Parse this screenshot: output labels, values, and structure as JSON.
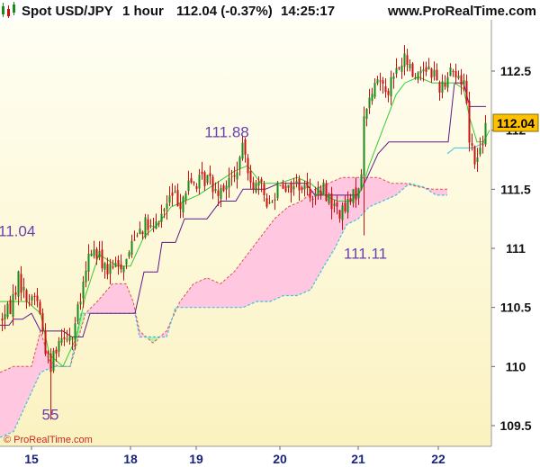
{
  "header": {
    "instrument": "Spot USD/JPY",
    "timeframe": "1 hour",
    "price_change": "112.04 (-0.37%)",
    "time": "14:25:17",
    "site": "www.ProRealTime.com"
  },
  "watermark": "© ProRealTime.com",
  "last_price_label": "112.04",
  "colors": {
    "background_top": "#fffff0",
    "background_bottom": "#fbf3c2",
    "candle_up": "#1b8a1b",
    "candle_down": "#cc1111",
    "tenkan": "#33cc33",
    "kijun": "#5a1a8a",
    "cloud_bearish": "#ffc8e0",
    "cloud_bullish": "#b8f0b0",
    "span_a": "#e05050",
    "span_b": "#40c0e0",
    "annotation": "#6a3fb0",
    "last_price_bg": "#ffc000"
  },
  "chart_data": {
    "type": "candlestick",
    "indicator": "Ichimoku cloud",
    "ylim": [
      109.3,
      113.05
    ],
    "y_ticks": [
      "109.5",
      "110",
      "110.5",
      "111",
      "111.5",
      "112",
      "112.5"
    ],
    "x_ticks": [
      "15",
      "18",
      "19",
      "20",
      "21",
      "22"
    ],
    "annotations": [
      {
        "text": "111.88",
        "price": 111.88
      },
      {
        "text": "11.04",
        "price": 111.04
      },
      {
        "text": "111.11",
        "price": 111.11
      },
      {
        "text": "55",
        "price": 109.55
      }
    ],
    "close_path": [
      [
        0,
        110.4
      ],
      [
        10,
        110.48
      ],
      [
        20,
        110.75
      ],
      [
        30,
        110.55
      ],
      [
        40,
        110.62
      ],
      [
        48,
        110.25
      ],
      [
        55,
        109.95
      ],
      [
        60,
        110.15
      ],
      [
        70,
        110.3
      ],
      [
        80,
        110.25
      ],
      [
        90,
        110.6
      ],
      [
        100,
        111.0
      ],
      [
        110,
        110.92
      ],
      [
        120,
        110.8
      ],
      [
        130,
        110.85
      ],
      [
        140,
        110.9
      ],
      [
        150,
        111.15
      ],
      [
        160,
        111.2
      ],
      [
        170,
        111.15
      ],
      [
        180,
        111.3
      ],
      [
        190,
        111.45
      ],
      [
        200,
        111.4
      ],
      [
        210,
        111.55
      ],
      [
        220,
        111.55
      ],
      [
        230,
        111.6
      ],
      [
        240,
        111.5
      ],
      [
        250,
        111.55
      ],
      [
        260,
        111.6
      ],
      [
        270,
        111.85
      ],
      [
        280,
        111.55
      ],
      [
        290,
        111.5
      ],
      [
        300,
        111.35
      ],
      [
        310,
        111.6
      ],
      [
        320,
        111.5
      ],
      [
        330,
        111.55
      ],
      [
        340,
        111.5
      ],
      [
        350,
        111.45
      ],
      [
        360,
        111.5
      ],
      [
        370,
        111.35
      ],
      [
        380,
        111.3
      ],
      [
        390,
        111.4
      ],
      [
        400,
        111.55
      ],
      [
        405,
        112.2
      ],
      [
        410,
        112.25
      ],
      [
        420,
        112.45
      ],
      [
        430,
        112.35
      ],
      [
        440,
        112.5
      ],
      [
        450,
        112.6
      ],
      [
        460,
        112.45
      ],
      [
        470,
        112.55
      ],
      [
        480,
        112.5
      ],
      [
        490,
        112.35
      ],
      [
        500,
        112.55
      ],
      [
        510,
        112.4
      ],
      [
        516,
        112.45
      ],
      [
        520,
        112.0
      ],
      [
        525,
        111.8
      ],
      [
        530,
        111.75
      ],
      [
        535,
        111.9
      ],
      [
        540,
        112.04
      ]
    ],
    "tenkan": [
      [
        0,
        110.55
      ],
      [
        30,
        110.55
      ],
      [
        45,
        110.45
      ],
      [
        55,
        110.1
      ],
      [
        70,
        110.0
      ],
      [
        85,
        110.25
      ],
      [
        95,
        110.6
      ],
      [
        110,
        110.95
      ],
      [
        130,
        110.85
      ],
      [
        145,
        110.85
      ],
      [
        160,
        111.1
      ],
      [
        175,
        111.2
      ],
      [
        190,
        111.35
      ],
      [
        205,
        111.4
      ],
      [
        220,
        111.45
      ],
      [
        240,
        111.55
      ],
      [
        260,
        111.65
      ],
      [
        275,
        111.7
      ],
      [
        290,
        111.55
      ],
      [
        310,
        111.55
      ],
      [
        330,
        111.6
      ],
      [
        345,
        111.55
      ],
      [
        360,
        111.45
      ],
      [
        375,
        111.4
      ],
      [
        390,
        111.4
      ],
      [
        402,
        111.5
      ],
      [
        410,
        111.7
      ],
      [
        420,
        111.9
      ],
      [
        430,
        112.1
      ],
      [
        440,
        112.3
      ],
      [
        450,
        112.4
      ],
      [
        465,
        112.45
      ],
      [
        480,
        112.4
      ],
      [
        495,
        112.4
      ],
      [
        505,
        112.4
      ],
      [
        515,
        112.35
      ],
      [
        522,
        112.1
      ],
      [
        530,
        111.9
      ],
      [
        537,
        111.9
      ],
      [
        544,
        112.0
      ]
    ],
    "kijun": [
      [
        0,
        110.35
      ],
      [
        10,
        110.35
      ],
      [
        15,
        110.4
      ],
      [
        25,
        110.4
      ],
      [
        35,
        110.45
      ],
      [
        45,
        110.3
      ],
      [
        55,
        110.3
      ],
      [
        70,
        110.3
      ],
      [
        80,
        110.25
      ],
      [
        92,
        110.25
      ],
      [
        100,
        110.45
      ],
      [
        150,
        110.45
      ],
      [
        160,
        110.8
      ],
      [
        175,
        110.8
      ],
      [
        180,
        111.05
      ],
      [
        195,
        111.05
      ],
      [
        205,
        111.25
      ],
      [
        230,
        111.25
      ],
      [
        245,
        111.4
      ],
      [
        262,
        111.4
      ],
      [
        270,
        111.5
      ],
      [
        295,
        111.5
      ],
      [
        310,
        111.55
      ],
      [
        340,
        111.55
      ],
      [
        350,
        111.45
      ],
      [
        372,
        111.45
      ],
      [
        385,
        111.45
      ],
      [
        398,
        111.45
      ],
      [
        408,
        111.6
      ],
      [
        420,
        111.8
      ],
      [
        432,
        111.9
      ],
      [
        448,
        111.9
      ],
      [
        470,
        111.9
      ],
      [
        495,
        111.9
      ],
      [
        498,
        111.9
      ],
      [
        505,
        112.4
      ],
      [
        515,
        112.4
      ],
      [
        522,
        112.2
      ],
      [
        540,
        112.2
      ]
    ],
    "senkou_a": [
      [
        0,
        109.95
      ],
      [
        15,
        110.0
      ],
      [
        25,
        110.0
      ],
      [
        35,
        110.0
      ],
      [
        45,
        110.3
      ],
      [
        55,
        110.05
      ],
      [
        65,
        110.0
      ],
      [
        78,
        110.0
      ],
      [
        95,
        110.45
      ],
      [
        108,
        110.55
      ],
      [
        125,
        110.7
      ],
      [
        140,
        110.7
      ],
      [
        148,
        110.55
      ],
      [
        155,
        110.3
      ],
      [
        170,
        110.2
      ],
      [
        185,
        110.3
      ],
      [
        200,
        110.55
      ],
      [
        215,
        110.7
      ],
      [
        230,
        110.75
      ],
      [
        245,
        110.7
      ],
      [
        260,
        110.8
      ],
      [
        275,
        110.95
      ],
      [
        290,
        111.1
      ],
      [
        305,
        111.25
      ],
      [
        320,
        111.35
      ],
      [
        335,
        111.4
      ],
      [
        350,
        111.5
      ],
      [
        365,
        111.55
      ],
      [
        380,
        111.6
      ],
      [
        395,
        111.6
      ],
      [
        408,
        111.6
      ],
      [
        420,
        111.6
      ],
      [
        435,
        111.55
      ],
      [
        450,
        111.55
      ],
      [
        465,
        111.52
      ],
      [
        480,
        111.5
      ],
      [
        497,
        111.5
      ]
    ],
    "senkou_b": [
      [
        0,
        109.4
      ],
      [
        15,
        109.45
      ],
      [
        30,
        109.7
      ],
      [
        45,
        109.95
      ],
      [
        60,
        110.0
      ],
      [
        78,
        110.0
      ],
      [
        90,
        110.45
      ],
      [
        110,
        110.45
      ],
      [
        140,
        110.45
      ],
      [
        150,
        110.45
      ],
      [
        155,
        110.25
      ],
      [
        170,
        110.25
      ],
      [
        185,
        110.25
      ],
      [
        195,
        110.5
      ],
      [
        215,
        110.5
      ],
      [
        235,
        110.5
      ],
      [
        255,
        110.5
      ],
      [
        270,
        110.5
      ],
      [
        285,
        110.55
      ],
      [
        300,
        110.55
      ],
      [
        315,
        110.6
      ],
      [
        330,
        110.6
      ],
      [
        345,
        110.65
      ],
      [
        360,
        110.85
      ],
      [
        372,
        111.0
      ],
      [
        385,
        111.2
      ],
      [
        398,
        111.25
      ],
      [
        410,
        111.35
      ],
      [
        425,
        111.4
      ],
      [
        440,
        111.45
      ],
      [
        455,
        111.55
      ],
      [
        470,
        111.52
      ],
      [
        485,
        111.45
      ],
      [
        497,
        111.45
      ]
    ],
    "chikou_like": [
      [
        497,
        111.8
      ],
      [
        505,
        111.85
      ],
      [
        515,
        111.85
      ],
      [
        525,
        111.85
      ],
      [
        540,
        111.9
      ]
    ]
  }
}
